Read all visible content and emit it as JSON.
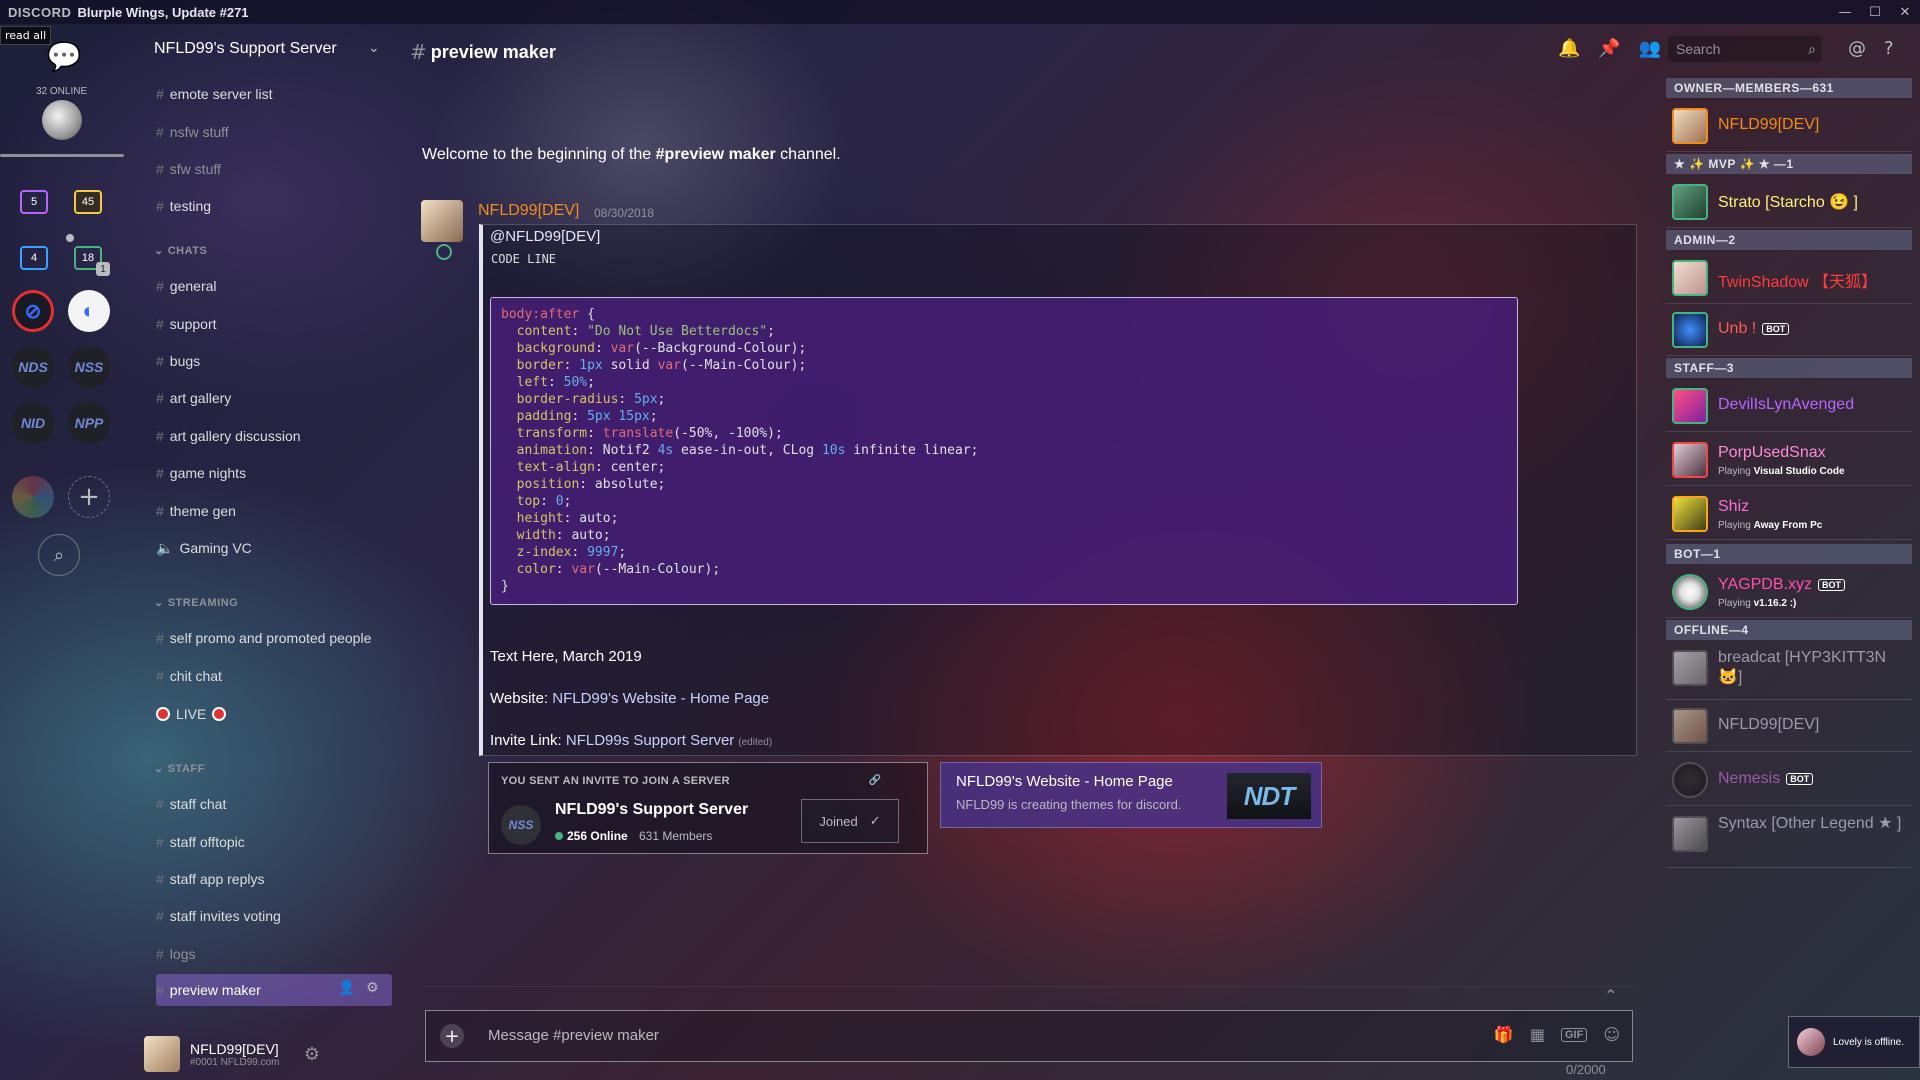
{
  "titlebar": {
    "brand": "DISCORD",
    "title": "Blurple Wings, Update #271"
  },
  "guilds": {
    "read_all": "read all",
    "online": "32 ONLINE",
    "folders": [
      "5",
      "45",
      "4",
      "18"
    ],
    "folder_sub": "1",
    "servers": [
      "NDS",
      "NSS",
      "NID",
      "NPP"
    ]
  },
  "server": {
    "name": "NFLD99's Support Server"
  },
  "channels": {
    "top": [
      "emote server list",
      "nsfw stuff",
      "sfw stuff",
      "testing"
    ],
    "cat_chats": "CHATS",
    "chats": [
      "general",
      "support",
      "bugs",
      "art gallery",
      "art gallery discussion",
      "game nights",
      "theme gen",
      "Gaming VC"
    ],
    "cat_streaming": "STREAMING",
    "streaming": [
      "self promo and promoted people",
      "chit chat"
    ],
    "live": "LIVE",
    "cat_staff": "STAFF",
    "staff": [
      "staff chat",
      "staff offtopic",
      "staff app replys",
      "staff invites voting",
      "logs",
      "preview maker"
    ]
  },
  "user_panel": {
    "name": "NFLD99[DEV]",
    "tag": "#0001 NFLD99.com"
  },
  "chat": {
    "channel": "preview maker",
    "welcome_pre": "Welcome to the beginning of the ",
    "welcome_channel": "#preview maker",
    "welcome_post": " channel.",
    "search_placeholder": "Search"
  },
  "message": {
    "author": "NFLD99[DEV]",
    "timestamp": "08/30/2018",
    "mention": "@NFLD99[DEV]",
    "code_label": "CODE LINE",
    "text_date": "Text Here, March 2019",
    "website_label": "Website: ",
    "website_link": "NFLD99's Website - Home Page",
    "invite_label": "Invite Link: ",
    "invite_link": "NFLD99s Support Server",
    "edited": "(edited)"
  },
  "invite_card": {
    "label": "YOU SENT AN INVITE TO JOIN A SERVER",
    "icon": "NSS",
    "name": "NFLD99's Support Server",
    "online": "256 Online",
    "members": "631 Members",
    "joined": "Joined"
  },
  "link_embed": {
    "title": "NFLD99's Website - Home Page",
    "description": "NFLD99 is creating themes for discord.",
    "thumb": "NDT"
  },
  "composer": {
    "placeholder": "Message #preview maker",
    "count": "0/2000"
  },
  "member_list": {
    "cat_owner": "OWNER—MEMBERS—631",
    "cat_mvp": "★ ✨ MVP ✨ ★ —1",
    "cat_admin": "ADMIN—2",
    "cat_staff": "STAFF—3",
    "cat_bot": "BOT—1",
    "cat_offline": "OFFLINE—4",
    "owner": "NFLD99[DEV]",
    "mvp": "Strato [Starcho 😉 ]",
    "admin1": "TwinShadow 【天狐】",
    "admin2": "Unb !",
    "staff1": "DevilIsLynAvenged",
    "staff2": "PorpUsedSnax",
    "staff2_act_pre": "Playing ",
    "staff2_act": "Visual Studio Code",
    "staff3": "Shiz",
    "staff3_act_pre": "Playing ",
    "staff3_act": "Away From Pc",
    "bot1": "YAGPDB.xyz",
    "bot1_act_pre": "Playing ",
    "bot1_act": "v1.16.2 :)",
    "off1": "breadcat [HYP3KITT3N 🐱]",
    "off2": "NFLD99[DEV]",
    "off3": "Nemesis",
    "off4": "Syntax [Other Legend ★ ]",
    "bot_badge": "BOT"
  },
  "toast": {
    "text": "Lovely is offline."
  },
  "colors": {
    "owner": "#f48a1a",
    "mvp": "#fff176",
    "admin": "#ff3b3b",
    "unb": "#ff5a5a",
    "devil": "#b964ff",
    "porp": "#ff8ad8",
    "shiz": "#ff6fd6",
    "yag": "#ff4fb0",
    "offline": "#9a9aa8"
  }
}
